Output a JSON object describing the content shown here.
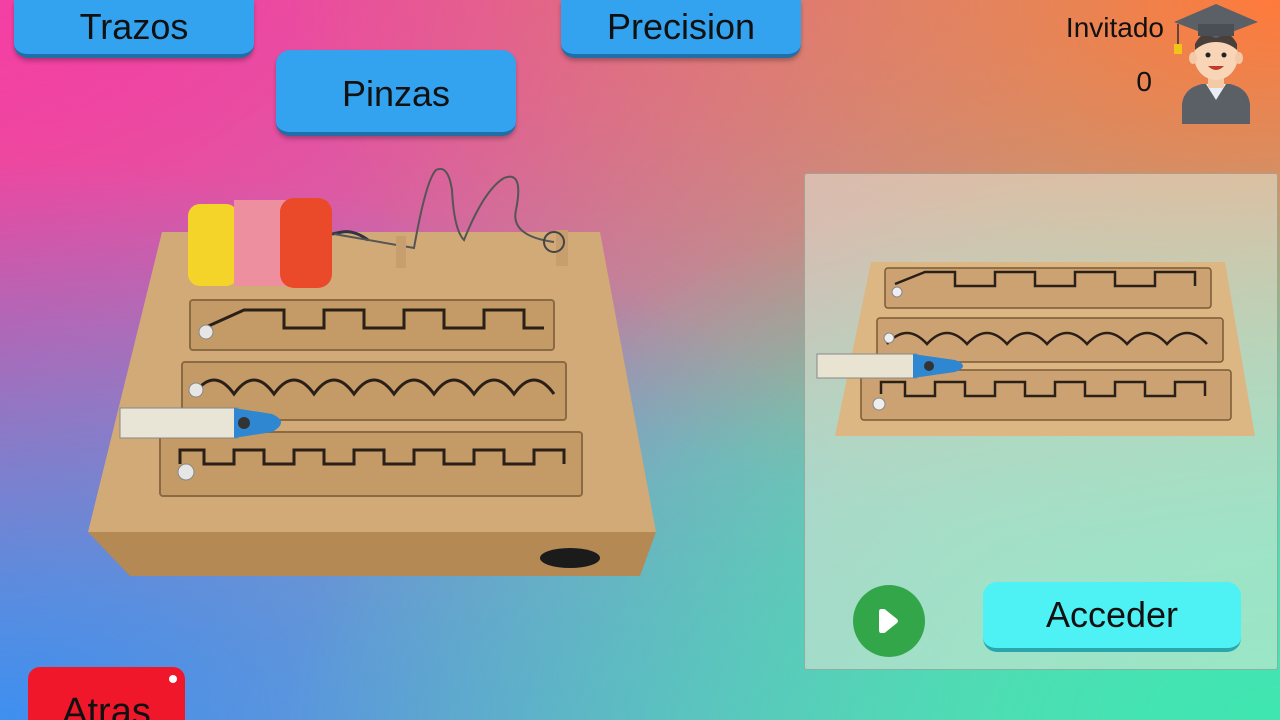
{
  "nav": {
    "trazos_label": "Trazos",
    "precision_label": "Precision",
    "pinzas_label": "Pinzas",
    "atras_label": "Atras"
  },
  "user": {
    "name": "Invitado",
    "score": "0",
    "avatar_icon": "graduate-avatar-icon"
  },
  "preview": {
    "play_icon": "play-icon",
    "acceder_label": "Acceder"
  },
  "colors": {
    "nav_button": "#33a3f0",
    "back_button": "#f0172a",
    "play_button": "#34a64a",
    "access_button": "#4ef2f4"
  }
}
